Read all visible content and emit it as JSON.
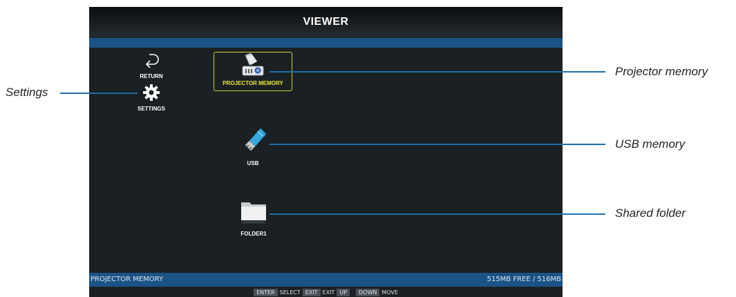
{
  "window": {
    "title": "VIEWER"
  },
  "sidebar": {
    "return_label": "RETURN",
    "settings_label": "SETTINGS"
  },
  "items": {
    "projector_memory_label": "PROJECTOR MEMORY",
    "usb_label": "USB",
    "folder_label": "FOLDER1"
  },
  "status_bar": {
    "source": "PROJECTOR MEMORY",
    "capacity": "515MB FREE / 516MB"
  },
  "hints": {
    "enter_key": "ENTER",
    "enter_action": "SELECT",
    "exit_key": "EXIT",
    "exit_action": "EXIT",
    "up_key": "UP",
    "down_key": "DOWN",
    "move_action": "MOVE"
  },
  "callouts": {
    "settings": "Settings",
    "projector_memory": "Projector memory",
    "usb_memory": "USB memory",
    "shared_folder": "Shared folder"
  },
  "colors": {
    "accent_blue": "#1b5387",
    "callout_line": "#1f6fae",
    "selection": "#d8d23a",
    "background": "#1a2023"
  }
}
